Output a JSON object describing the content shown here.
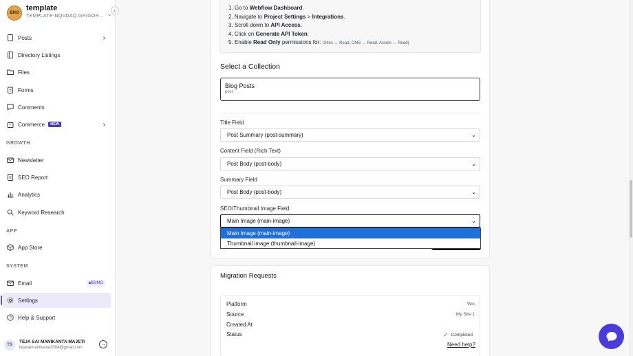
{
  "workspace": {
    "title": "template",
    "subtitle": "TEMPLATE-NQVDAQ.GRIGOR...",
    "logo_text": "BHO"
  },
  "nav": {
    "posts": "Posts",
    "directory": "Directory Listings",
    "files": "Files",
    "forms": "Forms",
    "comments": "Comments",
    "commerce": "Commerce",
    "commerce_badge": "NEW",
    "section_growth": "GROWTH",
    "newsletter": "Newsletter",
    "seo": "SEO Report",
    "analytics": "Analytics",
    "keyword": "Keyword Research",
    "section_app": "APP",
    "appstore": "App Store",
    "section_system": "SYSTEM",
    "email": "Email",
    "email_price": "$5/MO",
    "settings": "Settings",
    "help": "Help & Support"
  },
  "user": {
    "initials": "TS",
    "name": "TEJA SAI MANIKANTA MAJETI",
    "email": "tejasaimanikanta2004@gmail.com"
  },
  "steps": {
    "s1_pre": "1. Go to ",
    "s1_b": "Webflow Dashboard",
    "s1_post": ".",
    "s2_pre": "2. Navigate to ",
    "s2_b1": "Project Settings",
    "s2_mid": " > ",
    "s2_b2": "Integrations",
    "s2_post": ".",
    "s3_pre": "3. Scroll down to ",
    "s3_b": "API Access",
    "s3_post": ".",
    "s4_pre": "4. Click on ",
    "s4_b": "Generate API Token",
    "s4_post": ".",
    "s5_pre": "5. Enable ",
    "s5_b": "Read Only",
    "s5_mid": " permissions for: ",
    "s5_small": "(Sites → Read, CMS → Read, Assets → Read)"
  },
  "collection": {
    "heading": "Select a Collection",
    "name": "Blog Posts",
    "slug": "post"
  },
  "fields": {
    "title_label": "Title Field",
    "title_value": "Post Summary (post-summary)",
    "content_label": "Content Field (Rich Text)",
    "content_value": "Post Body (post-body)",
    "summary_label": "Summary Field",
    "summary_value": "Post Body (post-body)",
    "image_label": "SEO/Thumbnail Image Field",
    "image_value": "Main Image (main-image)"
  },
  "dropdown": {
    "options": [
      "Main Image (main-image)",
      "Thumbnail image (thumbnail-image)"
    ]
  },
  "migration": {
    "title": "Migration Requests",
    "platform_label": "Platform",
    "platform_value": "Wix",
    "source_label": "Source",
    "source_value": "My Site 1",
    "created_label": "Created At",
    "status_label": "Status",
    "status_value": "Completed",
    "help": "Need help?"
  },
  "colors": {
    "accent": "#4a3cdb",
    "selected_option": "#1f6fdc",
    "active_nav": "#ece9fb"
  }
}
